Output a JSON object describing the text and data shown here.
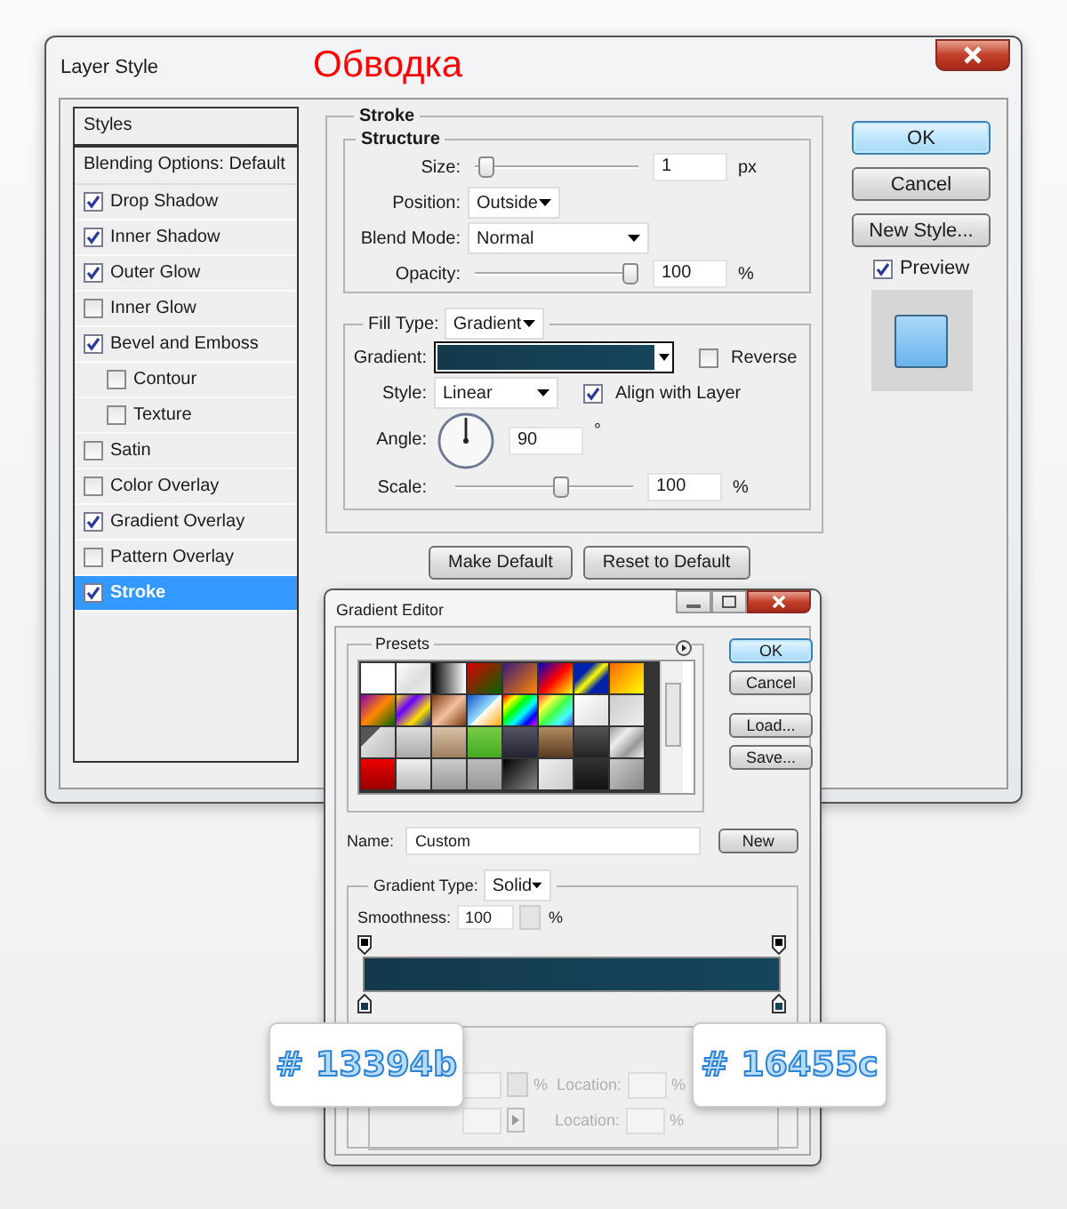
{
  "window": {
    "title": "Layer Style"
  },
  "annotation": "Обводка",
  "styles_list": {
    "header": "Styles",
    "blending": "Blending Options: Default",
    "items": [
      {
        "label": "Drop Shadow",
        "checked": true,
        "selected": false
      },
      {
        "label": "Inner Shadow",
        "checked": true,
        "selected": false
      },
      {
        "label": "Outer Glow",
        "checked": true,
        "selected": false
      },
      {
        "label": "Inner Glow",
        "checked": false,
        "selected": false
      },
      {
        "label": "Bevel and Emboss",
        "checked": true,
        "selected": false,
        "children": [
          {
            "label": "Contour",
            "checked": false,
            "selected": false
          },
          {
            "label": "Texture",
            "checked": false,
            "selected": false
          }
        ]
      },
      {
        "label": "Satin",
        "checked": false,
        "selected": false
      },
      {
        "label": "Color Overlay",
        "checked": false,
        "selected": false
      },
      {
        "label": "Gradient Overlay",
        "checked": true,
        "selected": false
      },
      {
        "label": "Pattern Overlay",
        "checked": false,
        "selected": false
      },
      {
        "label": "Stroke",
        "checked": true,
        "selected": true
      }
    ]
  },
  "stroke": {
    "title": "Stroke",
    "structure": {
      "title": "Structure",
      "size": {
        "label": "Size:",
        "level": 0.02,
        "value": "1",
        "unit": "px"
      },
      "position": {
        "label": "Position:",
        "value": "Outside"
      },
      "blend_mode": {
        "label": "Blend Mode:",
        "value": "Normal"
      },
      "opacity": {
        "label": "Opacity:",
        "level": 1,
        "value": "100",
        "unit": "%"
      }
    },
    "fill": {
      "label": "Fill Type:",
      "value": "Gradient",
      "gradient_label": "Gradient:",
      "reverse": {
        "label": "Reverse",
        "checked": false
      },
      "style": {
        "label": "Style:",
        "value": "Linear"
      },
      "align": {
        "label": "Align with Layer",
        "checked": true
      },
      "angle": {
        "label": "Angle:",
        "value": "90",
        "unit": "°"
      },
      "scale": {
        "label": "Scale:",
        "level": 0.6,
        "value": "100",
        "unit": "%"
      }
    },
    "buttons": [
      "Make Default",
      "Reset to Default"
    ]
  },
  "actions": [
    "OK",
    "Cancel",
    "New Style..."
  ],
  "preview": {
    "label": "Preview",
    "checked": true
  },
  "gradient_editor": {
    "title": "Gradient Editor",
    "presets_label": "Presets",
    "buttons": [
      "OK",
      "Cancel",
      "Load...",
      "Save..."
    ],
    "name": {
      "label": "Name:",
      "value": "Custom"
    },
    "new_button": "New",
    "gradient_type": {
      "label": "Gradient Type:",
      "value": "Solid"
    },
    "smoothness": {
      "label": "Smoothness:",
      "value": "100",
      "unit": "%"
    },
    "stops": {
      "opacity_unit": "%",
      "opacity_location_label": "Location:",
      "opacity_location_unit": "%",
      "color_location_label": "Location:",
      "color_location_unit": "%"
    }
  },
  "callouts": [
    "# 13394b",
    "# 16455c"
  ]
}
